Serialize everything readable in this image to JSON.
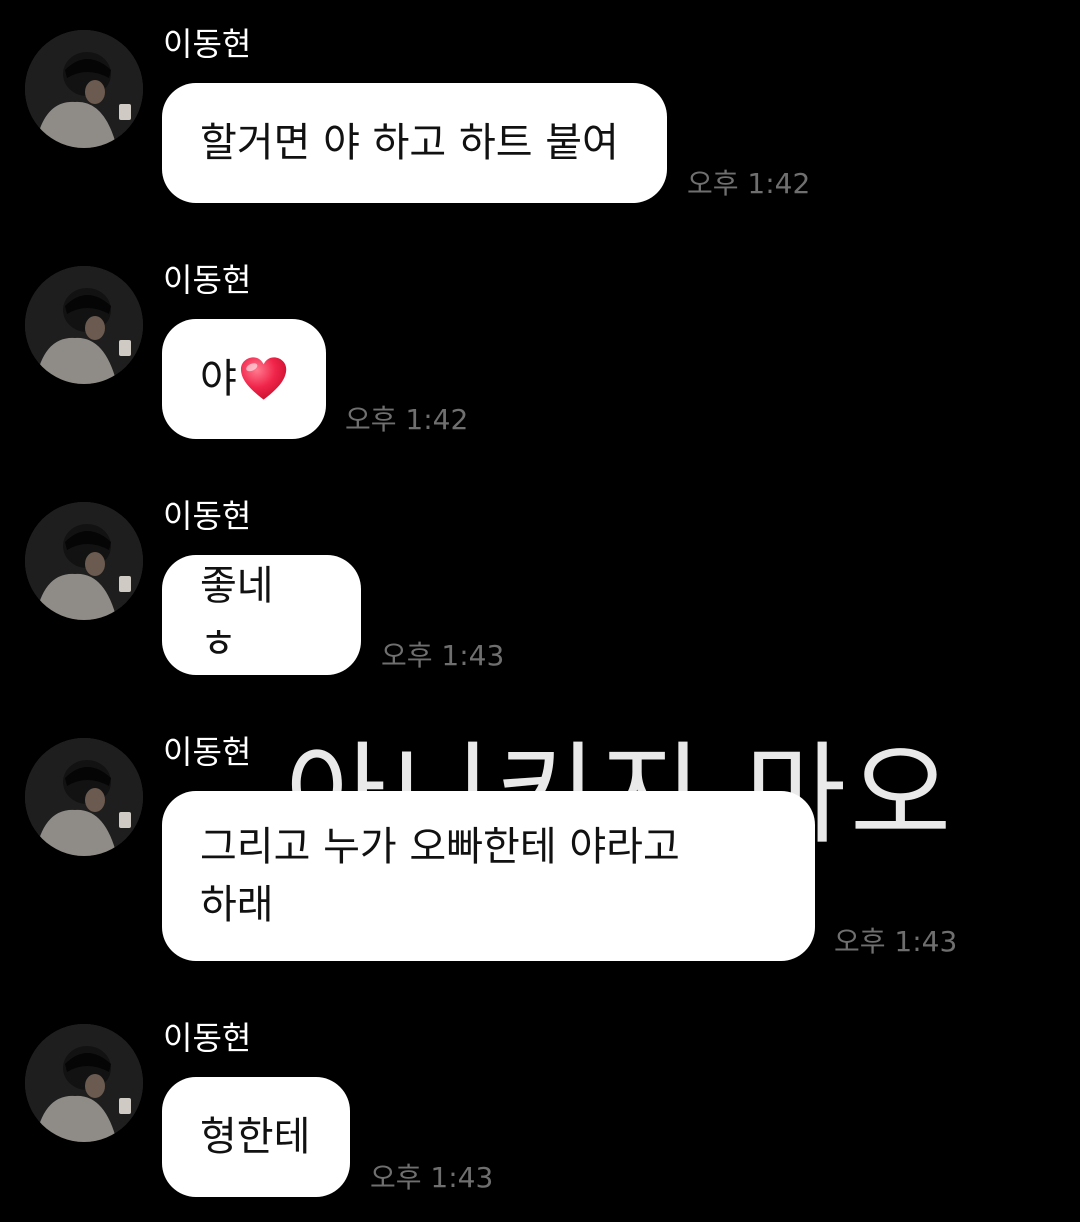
{
  "overlay_text": "아니키지 마오",
  "messages": [
    {
      "sender": "이동현",
      "text": "할거면 야 하고 하트 붙여",
      "time": "오후 1:42"
    },
    {
      "sender": "이동현",
      "text": "야",
      "emoji": "heart-emoji",
      "time": "오후 1:42"
    },
    {
      "sender": "이동현",
      "text": "좋네 ㅎ",
      "time": "오후 1:43"
    },
    {
      "sender": "이동현",
      "text": "그리고 누가 오빠한테 야라고\n하래",
      "time": "오후 1:43"
    },
    {
      "sender": "이동현",
      "text": "형한테",
      "time": "오후 1:43"
    }
  ],
  "colors": {
    "background": "#000000",
    "bubble": "#ffffff",
    "bubble_text": "#111111",
    "sender": "#ffffff",
    "time": "#6f6f6f",
    "heart": "#f0244a"
  }
}
